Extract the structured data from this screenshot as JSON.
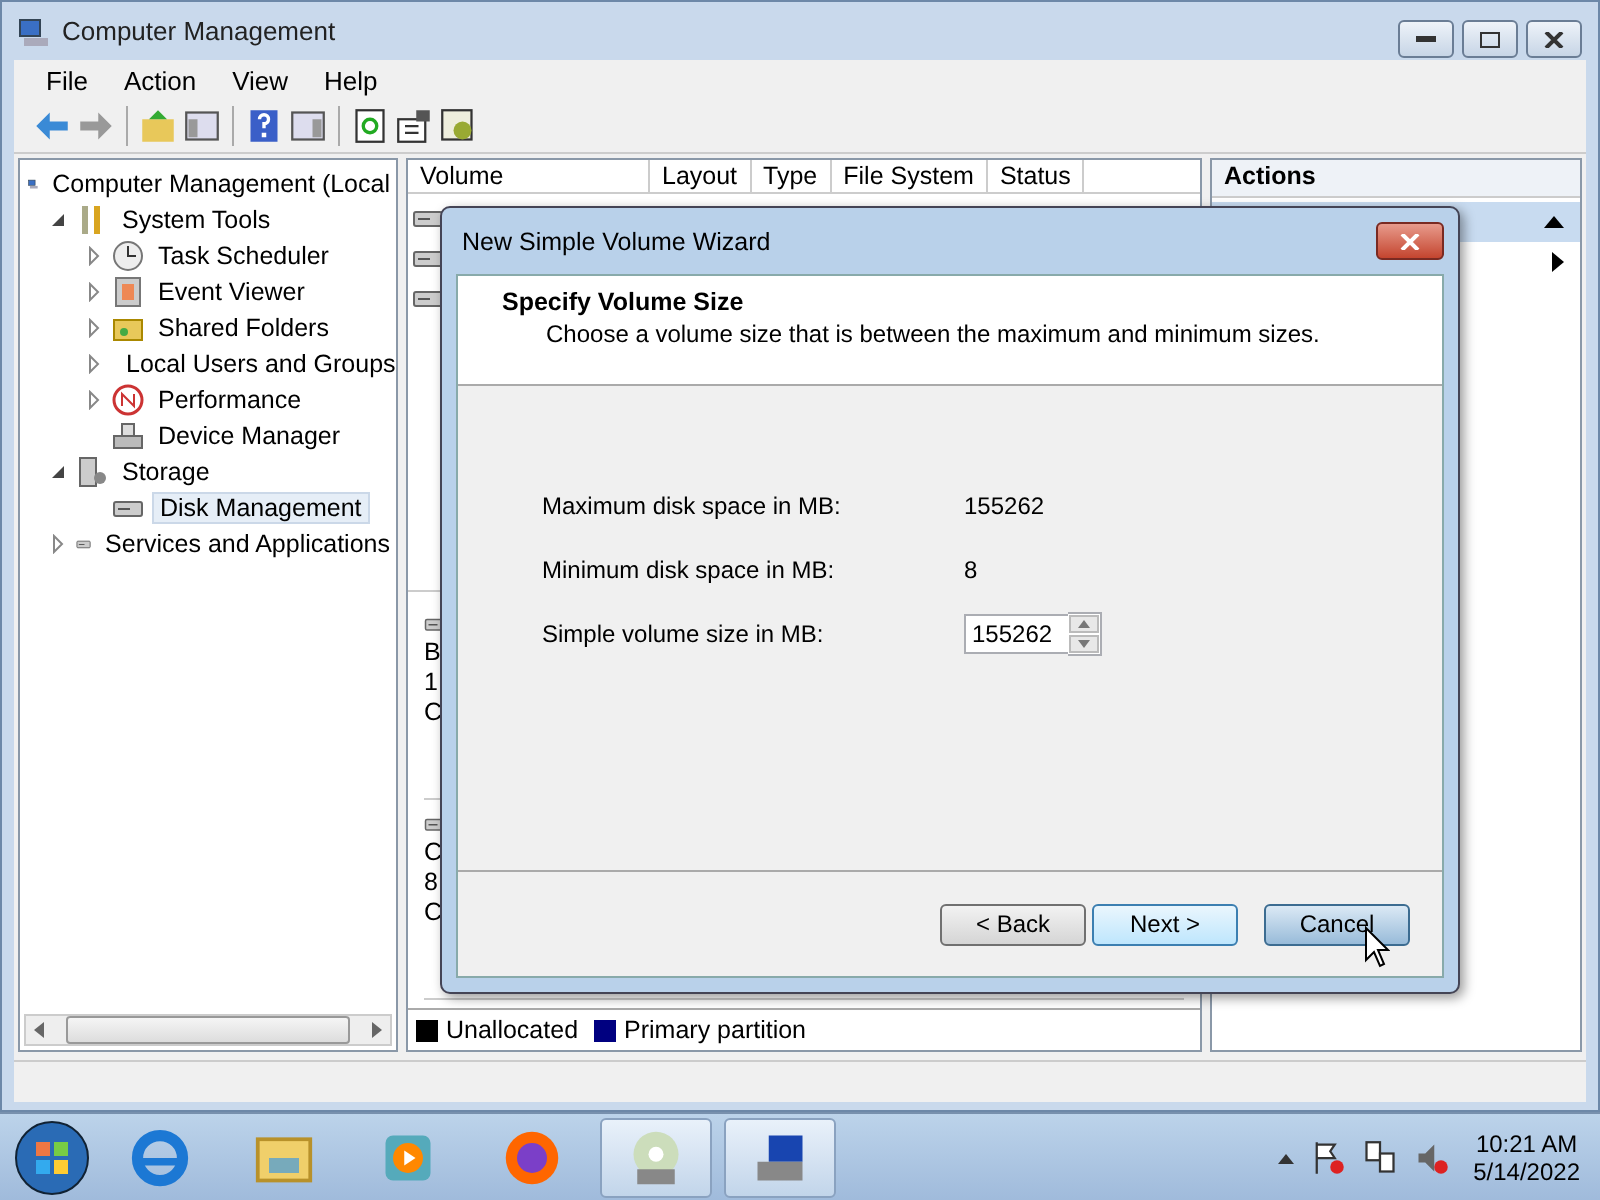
{
  "window": {
    "title": "Computer Management"
  },
  "menu": [
    "File",
    "Action",
    "View",
    "Help"
  ],
  "tree": [
    {
      "label": "Computer Management (Local",
      "selected": false,
      "children": [
        {
          "label": "System Tools",
          "expanded": true,
          "selected": false,
          "children": [
            {
              "label": "Task Scheduler",
              "expanded": false,
              "selected": false
            },
            {
              "label": "Event Viewer",
              "expanded": false,
              "selected": false
            },
            {
              "label": "Shared Folders",
              "expanded": false,
              "selected": false
            },
            {
              "label": "Local Users and Groups",
              "expanded": false,
              "selected": false
            },
            {
              "label": "Performance",
              "expanded": false,
              "selected": false
            },
            {
              "label": "Device Manager",
              "selected": false
            }
          ]
        },
        {
          "label": "Storage",
          "expanded": true,
          "selected": false,
          "children": [
            {
              "label": "Disk Management",
              "selected": true
            }
          ]
        },
        {
          "label": "Services and Applications",
          "expanded": false,
          "selected": false
        }
      ]
    }
  ],
  "volume_list": {
    "columns": [
      "Volume",
      "Layout",
      "Type",
      "File System",
      "Status"
    ]
  },
  "disk_panel": {
    "disks": [
      [
        "B",
        "1",
        "C"
      ],
      [
        "C",
        "8",
        "C"
      ]
    ]
  },
  "legend": [
    {
      "label": "Unallocated",
      "color": "#000000"
    },
    {
      "label": "Primary partition",
      "color": "#000080"
    }
  ],
  "actions": {
    "title": "Actions"
  },
  "dialog": {
    "title": "New Simple Volume Wizard",
    "heading": "Specify Volume Size",
    "subheading": "Choose a volume size that is between the maximum and minimum sizes.",
    "fields": [
      {
        "label": "Maximum disk space in MB:",
        "value": "155262",
        "kind": "text"
      },
      {
        "label": "Minimum disk space in MB:",
        "value": "8",
        "kind": "text"
      },
      {
        "label": "Simple volume size in MB:",
        "value": "155262",
        "kind": "spin"
      }
    ],
    "buttons": [
      {
        "label": "< Back",
        "kind": "normal"
      },
      {
        "label": "Next >",
        "kind": "default"
      },
      {
        "label": "Cancel",
        "kind": "hover"
      }
    ]
  },
  "clock": {
    "time": "10:21 AM",
    "date": "5/14/2022"
  }
}
